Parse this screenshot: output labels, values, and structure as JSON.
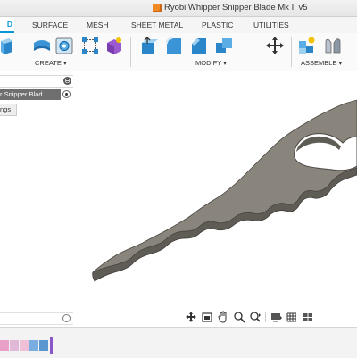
{
  "app": {
    "title": "Ryobi Whipper Snipper Blade Mk II v5"
  },
  "tabs": {
    "active_fragment": "D",
    "items": [
      "SURFACE",
      "MESH",
      "SHEET METAL",
      "PLASTIC",
      "UTILITIES"
    ]
  },
  "toolbar": {
    "groups": [
      "CREATE ▾",
      "MODIFY ▾",
      "ASSEMBLE ▾"
    ],
    "icons": [
      "new-component-icon",
      "extrude-icon",
      "revolve-icon",
      "hole-icon",
      "pattern-icon",
      "create-form-icon",
      "press-pull-icon",
      "fillet-icon",
      "chamfer-icon",
      "combine-icon",
      "move-copy-icon",
      "new-component-assemble-icon",
      "joint-icon"
    ]
  },
  "browser": {
    "collapse_symbol": "⊖",
    "document_label": "r Snipper Blad...",
    "settings_label": "ngs"
  },
  "navbar": {
    "icons": [
      "orbit-icon",
      "look-at-icon",
      "pan-icon",
      "zoom-icon",
      "zoom-window-icon",
      "display-settings-icon",
      "grid-settings-icon",
      "viewports-icon"
    ]
  },
  "colors": {
    "accent": "#0696d7",
    "part_top": "#8a857c",
    "part_side": "#5f5b55",
    "selected_item_bg": "#6f6f6f",
    "title_icon": "#f08a24"
  }
}
